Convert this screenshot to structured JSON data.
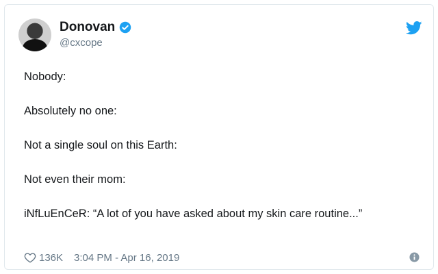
{
  "author": {
    "display_name": "Donovan",
    "handle": "@cxcope"
  },
  "icons": {
    "verified": "verified-badge-icon",
    "brand": "twitter-bird-icon",
    "like": "heart-icon",
    "info": "info-icon"
  },
  "colors": {
    "brand": "#1da1f2",
    "muted": "#657786",
    "text": "#14171a"
  },
  "tweet": {
    "lines": [
      "Nobody:",
      "Absolutely no one:",
      "Not a single soul on this Earth:",
      "Not even their mom:",
      "iNfLuEnCeR: “A lot of you have asked about my skin care routine...”"
    ]
  },
  "footer": {
    "likes": "136K",
    "timestamp": "3:04 PM - Apr 16, 2019"
  }
}
